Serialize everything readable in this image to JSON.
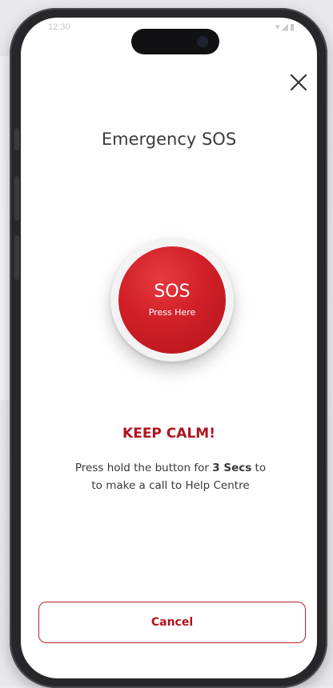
{
  "status_bar": {
    "time": "12:30",
    "icons": [
      "wifi-icon",
      "signal-icon",
      "battery-icon"
    ]
  },
  "header": {
    "title": "Emergency SOS",
    "close_icon": "close-icon"
  },
  "sos": {
    "label": "SOS",
    "sublabel": "Press Here",
    "color": "#d11f27"
  },
  "instructions": {
    "heading": "KEEP CALM!",
    "line1_before": "Press hold the button for ",
    "line1_bold": "3 Secs",
    "line1_after": " to",
    "line2": "to make a call to Help Centre"
  },
  "footer": {
    "cancel_label": "Cancel"
  },
  "colors": {
    "accent": "#b0141d",
    "text": "#3a3739"
  }
}
